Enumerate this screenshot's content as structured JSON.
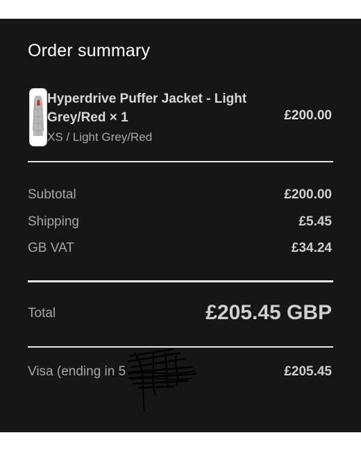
{
  "order_summary": {
    "title": "Order summary",
    "product": {
      "name": "Hyperdrive Puffer Jacket - Light Grey/Red × 1",
      "variant": "XS / Light Grey/Red",
      "price": "£200.00",
      "thumbnail_icon": "jacket-thumbnail"
    },
    "subtotal": {
      "label": "Subtotal",
      "value": "£200.00"
    },
    "shipping": {
      "label": "Shipping",
      "value": "£5.45"
    },
    "vat": {
      "label": "GB VAT",
      "value": "£34.24"
    },
    "total": {
      "label": "Total",
      "value": "£205.45 GBP"
    },
    "payment": {
      "label": "Visa (ending in 5",
      "value": "£205.45"
    }
  },
  "colors": {
    "panel_background": "#161616",
    "page_background": "#ffffff",
    "divider": "#e8e8e8"
  }
}
